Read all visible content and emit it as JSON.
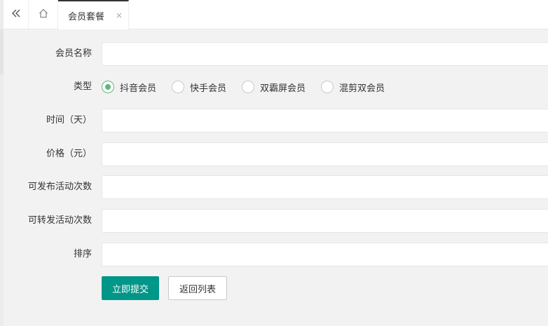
{
  "tabs": {
    "collapse_icon": "double-chevron-left-icon",
    "home_icon": "home-icon",
    "active_label": "会员套餐",
    "close_icon": "close-icon"
  },
  "form": {
    "name_label": "会员名称",
    "name_value": "",
    "type_label": "类型",
    "type_options": [
      "抖音会员",
      "快手会员",
      "双霸屏会员",
      "混剪双会员"
    ],
    "type_selected": "抖音会员",
    "days_label": "时间（天）",
    "days_value": "",
    "price_label": "价格（元）",
    "price_value": "",
    "publish_label": "可发布活动次数",
    "publish_value": "",
    "forward_label": "可转发活动次数",
    "forward_value": "",
    "sort_label": "排序",
    "sort_value": "",
    "submit_label": "立即提交",
    "back_label": "返回列表"
  },
  "colors": {
    "primary": "#009688",
    "radio_checked": "#5fb878",
    "background": "#f2f2f2"
  }
}
